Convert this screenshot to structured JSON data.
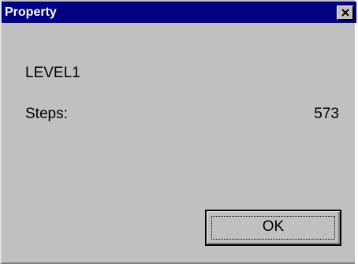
{
  "window": {
    "title": "Property",
    "close_icon": "close-icon"
  },
  "content": {
    "level_name": "LEVEL1",
    "steps_label": "Steps:",
    "steps_value": "573"
  },
  "buttons": {
    "ok_label": "OK"
  },
  "colors": {
    "titlebar": "#000080",
    "face": "#c0c0c0",
    "title_text": "#ffffff"
  }
}
